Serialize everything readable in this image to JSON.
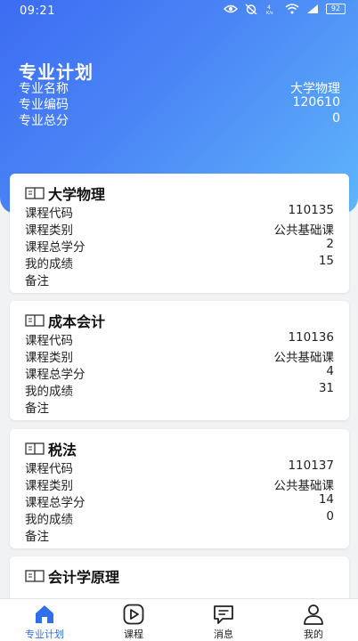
{
  "status": {
    "time": "09:21",
    "battery": "92"
  },
  "header": {
    "title": "专业计划",
    "rows": [
      {
        "label": "专业名称",
        "value": "大学物理"
      },
      {
        "label": "专业编码",
        "value": "120610"
      },
      {
        "label": "专业总分",
        "value": "0"
      }
    ]
  },
  "courses": [
    {
      "name": "大学物理",
      "code_label": "课程代码",
      "code": "110135",
      "type_label": "课程类别",
      "type": "公共基础课",
      "credit_label": "课程总学分",
      "credit": "2",
      "score_label": "我的成绩",
      "score": "15",
      "note_label": "备注"
    },
    {
      "name": "成本会计",
      "code_label": "课程代码",
      "code": "110136",
      "type_label": "课程类别",
      "type": "公共基础课",
      "credit_label": "课程总学分",
      "credit": "4",
      "score_label": "我的成绩",
      "score": "31",
      "note_label": "备注"
    },
    {
      "name": "税法",
      "code_label": "课程代码",
      "code": "110137",
      "type_label": "课程类别",
      "type": "公共基础课",
      "credit_label": "课程总学分",
      "credit": "14",
      "score_label": "我的成绩",
      "score": "0",
      "note_label": "备注"
    },
    {
      "name": "会计学原理"
    }
  ],
  "tabs": [
    {
      "label": "专业计划",
      "icon": "home-icon",
      "active": true
    },
    {
      "label": "课程",
      "icon": "play-icon"
    },
    {
      "label": "消息",
      "icon": "message-icon"
    },
    {
      "label": "我的",
      "icon": "user-icon"
    }
  ],
  "colors": {
    "accent": "#2f6fea",
    "header_start": "#3c6cf2",
    "header_end": "#5fb6fb"
  }
}
